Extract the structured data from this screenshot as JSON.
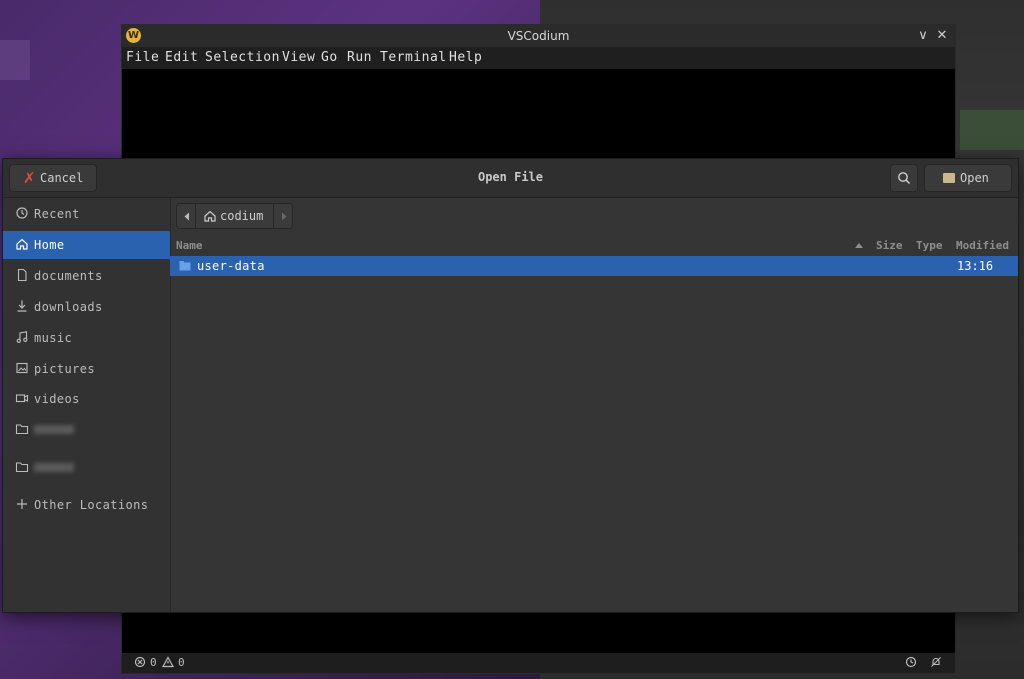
{
  "vscodium": {
    "logo_letter": "W",
    "title": "VSCodium",
    "controls": {
      "minimize": "∨",
      "close": "✕"
    },
    "menu": [
      "File",
      "Edit",
      "Selection",
      "View",
      "Go",
      "Run",
      "Terminal",
      "Help"
    ],
    "status": {
      "errors": "0",
      "warnings": "0"
    }
  },
  "dialog": {
    "title": "Open File",
    "cancel_label": "Cancel",
    "open_label": "Open",
    "sidebar": [
      {
        "label": "Recent",
        "icon": "clock-icon"
      },
      {
        "label": "Home",
        "icon": "home-icon",
        "active": true
      },
      {
        "label": "documents",
        "icon": "document-icon"
      },
      {
        "label": "downloads",
        "icon": "download-icon"
      },
      {
        "label": "music",
        "icon": "music-icon"
      },
      {
        "label": "pictures",
        "icon": "picture-icon"
      },
      {
        "label": "videos",
        "icon": "video-icon"
      },
      {
        "label": "",
        "icon": "folder-icon"
      },
      {
        "label": "",
        "icon": "folder-icon"
      },
      {
        "label": "Other Locations",
        "icon": "plus-icon"
      }
    ],
    "path": {
      "current": "codium"
    },
    "columns": {
      "name": "Name",
      "size": "Size",
      "type": "Type",
      "modified": "Modified"
    },
    "files": [
      {
        "name": "user-data",
        "size": "",
        "type": "",
        "modified": "13:16",
        "selected": true
      }
    ]
  },
  "colors": {
    "accent": "#2a62b0",
    "cancel_icon": "#e04a3a",
    "logo": "#e8b33a"
  }
}
